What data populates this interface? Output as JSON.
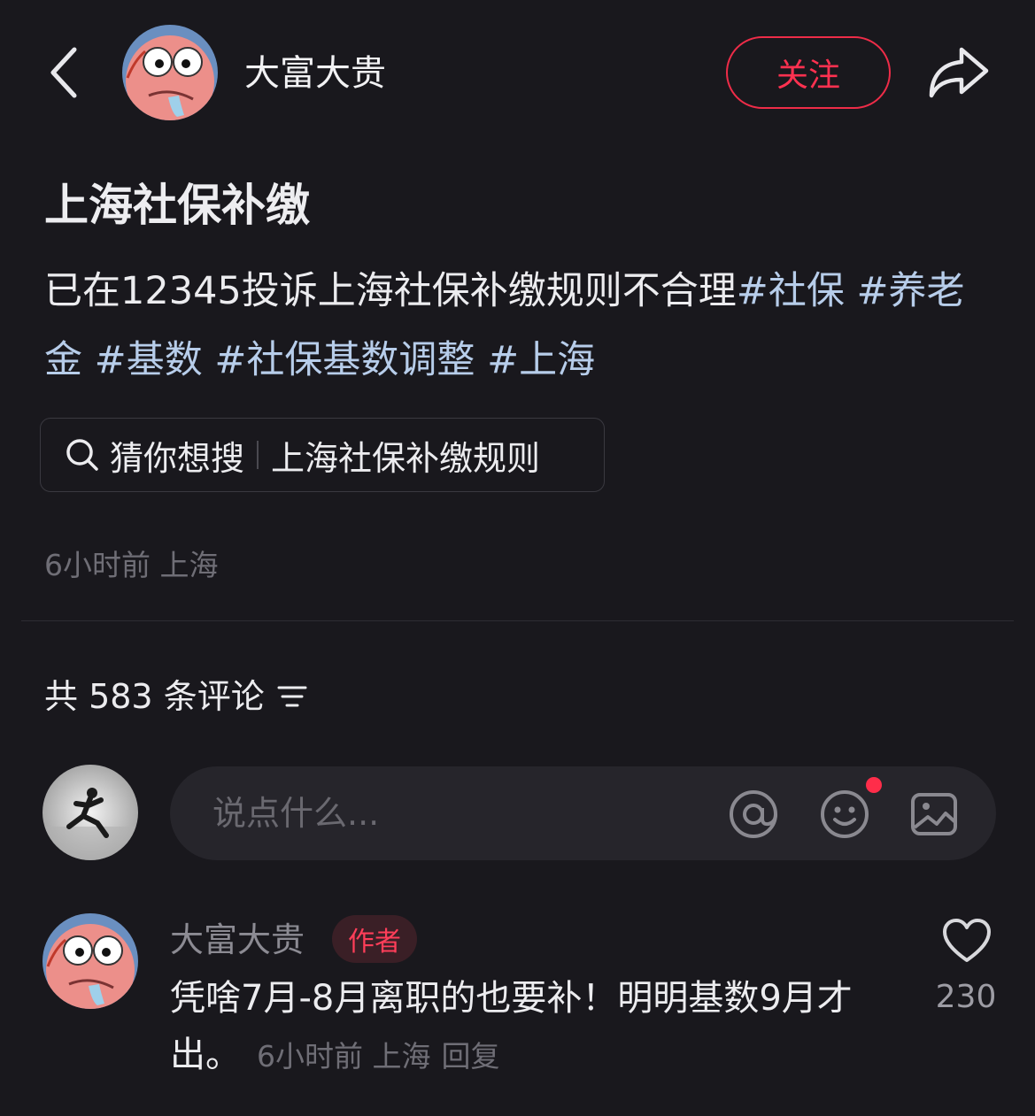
{
  "header": {
    "back_icon": "chevron-left-icon",
    "author_name": "大富大贵",
    "follow_label": "关注",
    "share_icon": "share-arrow-icon",
    "accent_color": "#ff3150"
  },
  "post": {
    "title": "上海社保补缴",
    "body_text": "已在12345投诉上海社保补缴规则不合理",
    "tags": [
      "#社保",
      "#养老金",
      "#基数",
      "#社保基数调整",
      "#上海"
    ],
    "tag_color": "#b7cdea",
    "guess_search": {
      "label": "猜你想搜",
      "query": "上海社保补缴规则"
    },
    "meta": "6小时前 上海"
  },
  "comments": {
    "header": "共 583 条评论",
    "sort_icon": "sort-filter-icon",
    "input_placeholder": "说点什么...",
    "input_icons": [
      "at-icon",
      "emoji-icon",
      "image-icon"
    ],
    "items": [
      {
        "author": "大富大贵",
        "badge": "作者",
        "text": "凭啥7月-8月离职的也要补！明明基数9月才出。",
        "time": "6小时前",
        "location": "上海",
        "reply_label": "回复",
        "likes": "230"
      }
    ]
  }
}
